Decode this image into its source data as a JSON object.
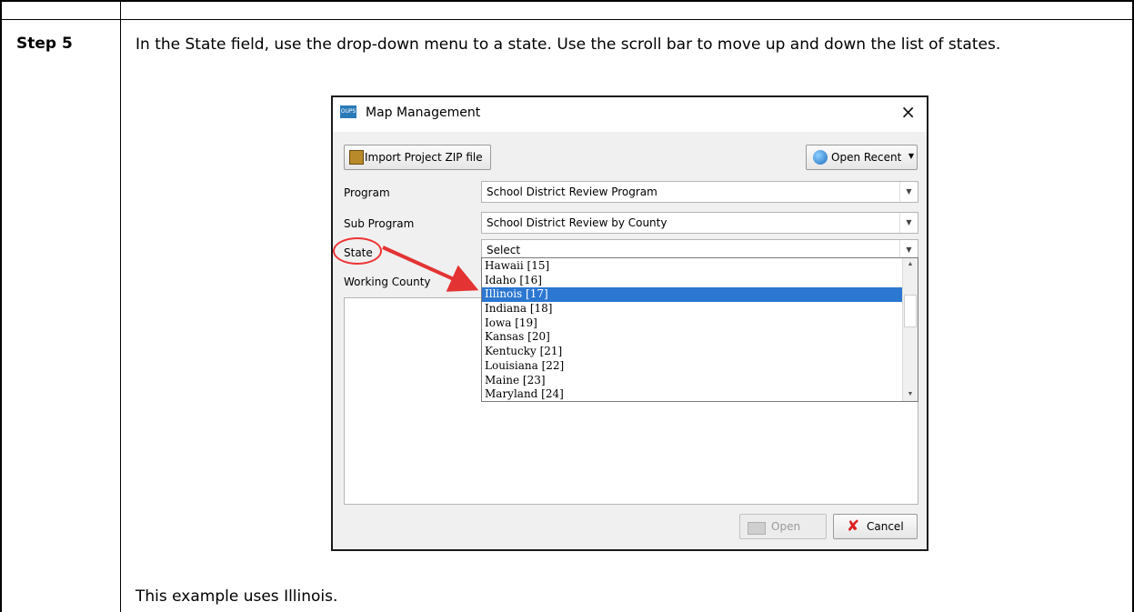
{
  "step": {
    "label": "Step 5"
  },
  "instruction": "In the State field, use the drop-down menu to a state. Use the scroll bar to move up and down the list of states.",
  "caption": "This example uses Illinois.",
  "dialog": {
    "app_icon_text": "OUPS",
    "title": "Map Management",
    "close_glyph": "×",
    "import_button": "Import Project ZIP file",
    "open_recent_button": "Open Recent",
    "program": {
      "label": "Program",
      "value": "School District Review Program"
    },
    "sub_program": {
      "label": "Sub Program",
      "value": "School District Review by County"
    },
    "state": {
      "label": "State",
      "value": "Select"
    },
    "working_county": {
      "label": "Working County"
    },
    "state_options": [
      "Hawaii [15]",
      "Idaho [16]",
      "Illinois [17]",
      "Indiana [18]",
      "Iowa [19]",
      "Kansas [20]",
      "Kentucky [21]",
      "Louisiana [22]",
      "Maine [23]",
      "Maryland [24]"
    ],
    "selected_option": "Illinois [17]",
    "open_button": "Open",
    "cancel_button": "Cancel"
  },
  "colors": {
    "selection": "#2b77d1",
    "annotation": "#e33333"
  },
  "icons": [
    "import-zip-icon",
    "globe-icon",
    "folder-icon",
    "cancel-x-icon",
    "close-icon",
    "chevron-down-icon"
  ]
}
